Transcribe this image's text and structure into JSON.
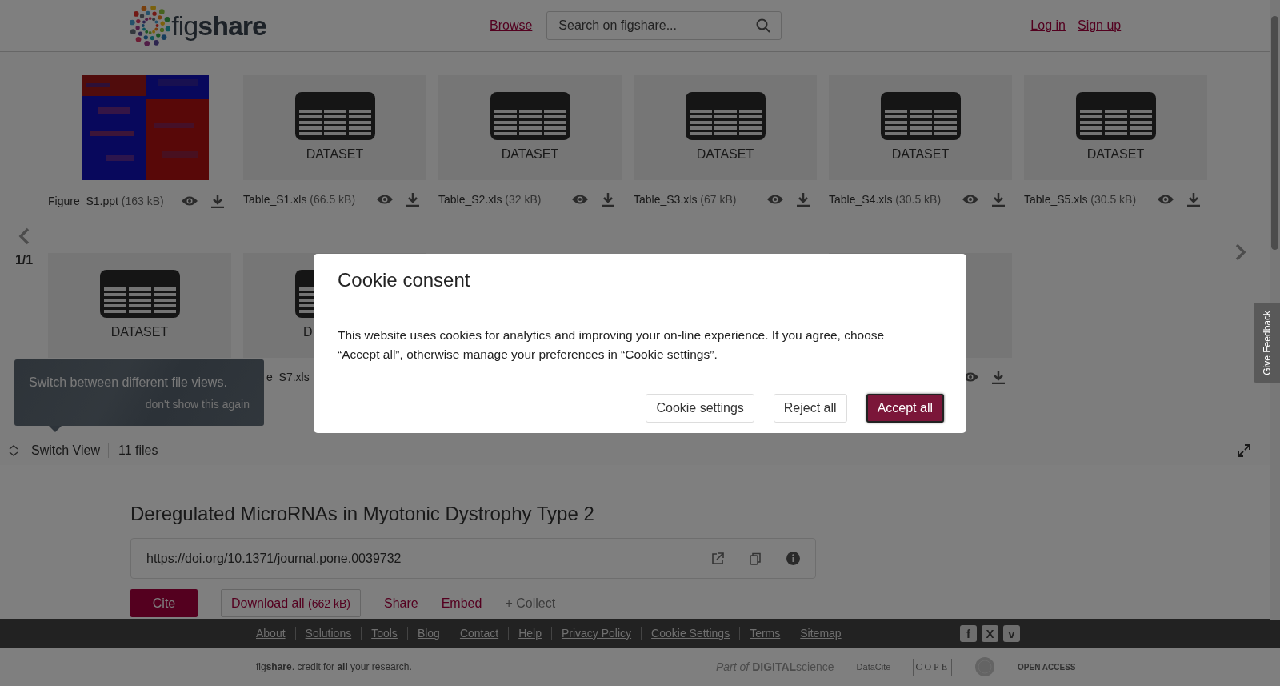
{
  "header": {
    "logo_text": "fig**share**",
    "nav_link": "Browse",
    "search": {
      "placeholder": "Search on figshare..."
    },
    "auth_links": [
      "Log in",
      "Sign up"
    ]
  },
  "viewer": {
    "page_indicator": "1/1",
    "files": [
      {
        "name": "Figure_S1.ppt",
        "size": "(163 kB)"
      },
      {
        "kind": "dataset",
        "label": "DATASET",
        "name": "Table_S1.xls",
        "size": "(66.5 kB)"
      },
      {
        "kind": "dataset",
        "label": "DATASET",
        "name": "Table_S2.xls",
        "size": "(32 kB)"
      },
      {
        "kind": "dataset",
        "label": "DATASET",
        "name": "Table_S3.xls",
        "size": "(67 kB)"
      },
      {
        "kind": "dataset",
        "label": "DATASET",
        "name": "Table_S4.xls",
        "size": "(30.5 kB)"
      },
      {
        "kind": "dataset",
        "label": "DATASET",
        "name": "Table_S5.xls",
        "size": "(30.5 kB)"
      }
    ],
    "files_row_2": [
      {
        "kind": "dataset",
        "label": "DATASET"
      },
      {
        "kind": "dataset",
        "label": "D",
        "caption": "e_S7.xls"
      },
      {
        "kind": "empty"
      },
      {
        "kind": "empty"
      },
      {
        "kind": "actions"
      }
    ],
    "tooltip": {
      "message": "Switch between different file views.",
      "dismiss": "don't show this again"
    },
    "switch_view": "Switch View",
    "file_count": "11 files"
  },
  "item": {
    "title": "Deregulated MicroRNAs in Myotonic Dystrophy Type 2",
    "doi": "https://doi.org/10.1371/journal.pone.0039732",
    "actions": [
      {
        "kind": "primary",
        "label": "Cite"
      },
      {
        "kind": "outlined",
        "label": "Download all",
        "size": "(662 kB)"
      },
      {
        "kind": "link",
        "label": "Share"
      },
      {
        "kind": "link",
        "label": "Embed"
      },
      {
        "kind": "muted",
        "label": "+ Collect"
      }
    ]
  },
  "footer": {
    "links": [
      "About",
      "Solutions",
      "Tools",
      "Blog",
      "Contact",
      "Help",
      "Privacy Policy",
      "Cookie Settings",
      "Terms",
      "Sitemap"
    ],
    "social": [
      {
        "glyph": "f"
      },
      {
        "glyph": "X"
      },
      {
        "glyph": "v"
      }
    ],
    "tagline": "fig**share**. credit for **all** your research.",
    "partners": [
      {
        "kind": "digital_science",
        "text": "*Part of* **DIGITAL**science"
      },
      {
        "kind": "datacite",
        "text": "DataCite"
      },
      {
        "kind": "cope",
        "text": "COPE"
      },
      {
        "kind": "seal"
      },
      {
        "kind": "open_access",
        "text": "OPEN ACCESS"
      }
    ]
  },
  "feedback_tab": "Give Feedback",
  "cookie_dialog": {
    "title": "Cookie consent",
    "message": "This website uses cookies for analytics and improving your on-line experience. If you agree, choose “Accept all”, otherwise manage your preferences in “Cookie settings”.",
    "buttons": [
      {
        "kind": "secondary",
        "label": "Cookie settings",
        "focused": false
      },
      {
        "kind": "secondary",
        "label": "Reject all",
        "focused": false
      },
      {
        "kind": "primary",
        "label": "Accept all",
        "focused": true
      }
    ]
  }
}
